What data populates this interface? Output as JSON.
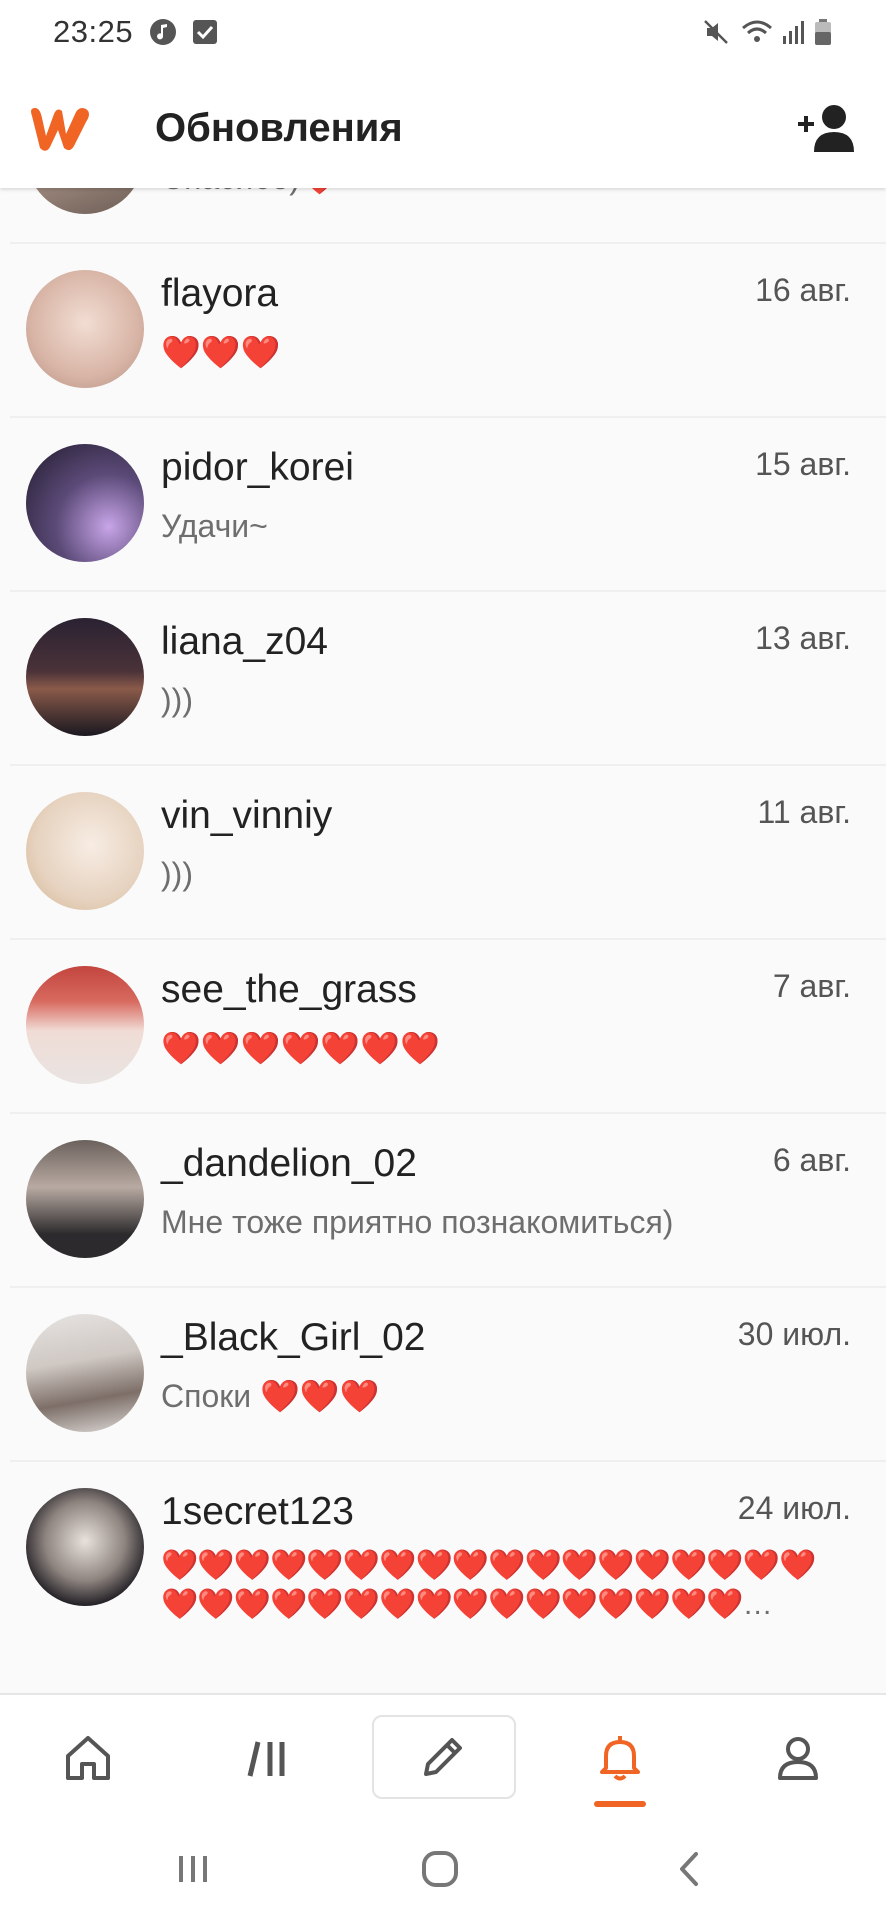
{
  "status_bar": {
    "time": "23:25",
    "left_icons": [
      "music-note-icon",
      "checkbox-icon"
    ],
    "right_icons": [
      "mute-icon",
      "wifi-icon",
      "signal-icon",
      "battery-icon"
    ]
  },
  "app_bar": {
    "title": "Обновления",
    "logo": "wattpad-logo",
    "action_icon": "add-user-icon",
    "accent_color": "#f06424"
  },
  "notifications": [
    {
      "username": "",
      "date": "",
      "message": "Спасибо)❤️",
      "avatar_color": "#c7b6a8"
    },
    {
      "username": "flayora",
      "date": "16 авг.",
      "message": "❤️❤️❤️",
      "avatar_color": "#e8cfc4"
    },
    {
      "username": "pidor_korei",
      "date": "15 авг.",
      "message": "Удачи~",
      "avatar_color": "#3a2d4a"
    },
    {
      "username": "liana_z04",
      "date": "13 авг.",
      "message": ")))",
      "avatar_color": "#1d1a2c"
    },
    {
      "username": "vin_vinniy",
      "date": "11 авг.",
      "message": ")))",
      "avatar_color": "#efe3d6"
    },
    {
      "username": "see_the_grass",
      "date": "7 авг.",
      "message": "❤️❤️❤️❤️❤️❤️❤️",
      "avatar_color": "#c95c55"
    },
    {
      "username": "_dandelion_02",
      "date": "6 авг.",
      "message": "Мне тоже приятно познакомиться)",
      "avatar_color": "#8d8580"
    },
    {
      "username": "_Black_Girl_02",
      "date": "30 июл.",
      "message": "Споки ❤️❤️❤️",
      "avatar_color": "#d6d2cf"
    },
    {
      "username": "1secret123",
      "date": "24 июл.",
      "message": "❤️❤️❤️❤️❤️❤️❤️❤️❤️❤️❤️❤️❤️❤️❤️❤️❤️❤️❤️❤️❤️❤️❤️❤️❤️❤️❤️❤️❤️❤️❤️❤️❤️❤️…",
      "avatar_color": "#2b2a33"
    }
  ],
  "bottom_nav": [
    {
      "name": "home-icon",
      "active": false
    },
    {
      "name": "library-icon",
      "active": false
    },
    {
      "name": "write-icon",
      "active": false
    },
    {
      "name": "bell-icon",
      "active": true
    },
    {
      "name": "profile-icon",
      "active": false
    }
  ],
  "system_nav": [
    "recents-icon",
    "home-circle-icon",
    "back-icon"
  ]
}
